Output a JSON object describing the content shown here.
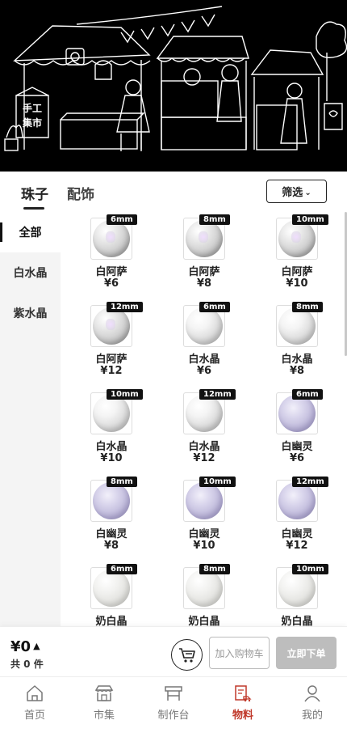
{
  "tabs": {
    "beads": "珠子",
    "accessories": "配饰",
    "filter": "筛选"
  },
  "sidebar": {
    "items": [
      {
        "label": "全部"
      },
      {
        "label": "白水晶"
      },
      {
        "label": "紫水晶"
      }
    ]
  },
  "products": [
    {
      "name": "白阿萨",
      "price": "¥6",
      "size": "6mm",
      "style": "rutile"
    },
    {
      "name": "白阿萨",
      "price": "¥8",
      "size": "8mm",
      "style": "rutile"
    },
    {
      "name": "白阿萨",
      "price": "¥10",
      "size": "10mm",
      "style": "rutile"
    },
    {
      "name": "白阿萨",
      "price": "¥12",
      "size": "12mm",
      "style": "rutile"
    },
    {
      "name": "白水晶",
      "price": "¥6",
      "size": "6mm",
      "style": "clear"
    },
    {
      "name": "白水晶",
      "price": "¥8",
      "size": "8mm",
      "style": "clear"
    },
    {
      "name": "白水晶",
      "price": "¥10",
      "size": "10mm",
      "style": "clear"
    },
    {
      "name": "白水晶",
      "price": "¥12",
      "size": "12mm",
      "style": "clear"
    },
    {
      "name": "白幽灵",
      "price": "¥6",
      "size": "6mm",
      "style": "phantom"
    },
    {
      "name": "白幽灵",
      "price": "¥8",
      "size": "8mm",
      "style": "phantom"
    },
    {
      "name": "白幽灵",
      "price": "¥10",
      "size": "10mm",
      "style": "phantom"
    },
    {
      "name": "白幽灵",
      "price": "¥12",
      "size": "12mm",
      "style": "phantom"
    },
    {
      "name": "奶白晶",
      "price": "",
      "size": "6mm",
      "style": "milky"
    },
    {
      "name": "奶白晶",
      "price": "",
      "size": "8mm",
      "style": "milky"
    },
    {
      "name": "奶白晶",
      "price": "",
      "size": "10mm",
      "style": "milky"
    }
  ],
  "cart": {
    "total": "¥0",
    "count": "共 0 件",
    "add_label": "加入购物车",
    "buy_label": "立即下单"
  },
  "banner": {
    "sign": [
      "手工",
      "集市"
    ]
  },
  "nav": {
    "items": [
      {
        "label": "首页",
        "icon": "home-icon"
      },
      {
        "label": "市集",
        "icon": "market-icon"
      },
      {
        "label": "制作台",
        "icon": "workbench-icon"
      },
      {
        "label": "物料",
        "icon": "materials-icon"
      },
      {
        "label": "我的",
        "icon": "profile-icon"
      }
    ]
  },
  "colors": {
    "active": "#c0392b",
    "disabled_button": "#bdbdbd",
    "banner_bg": "#000000"
  }
}
